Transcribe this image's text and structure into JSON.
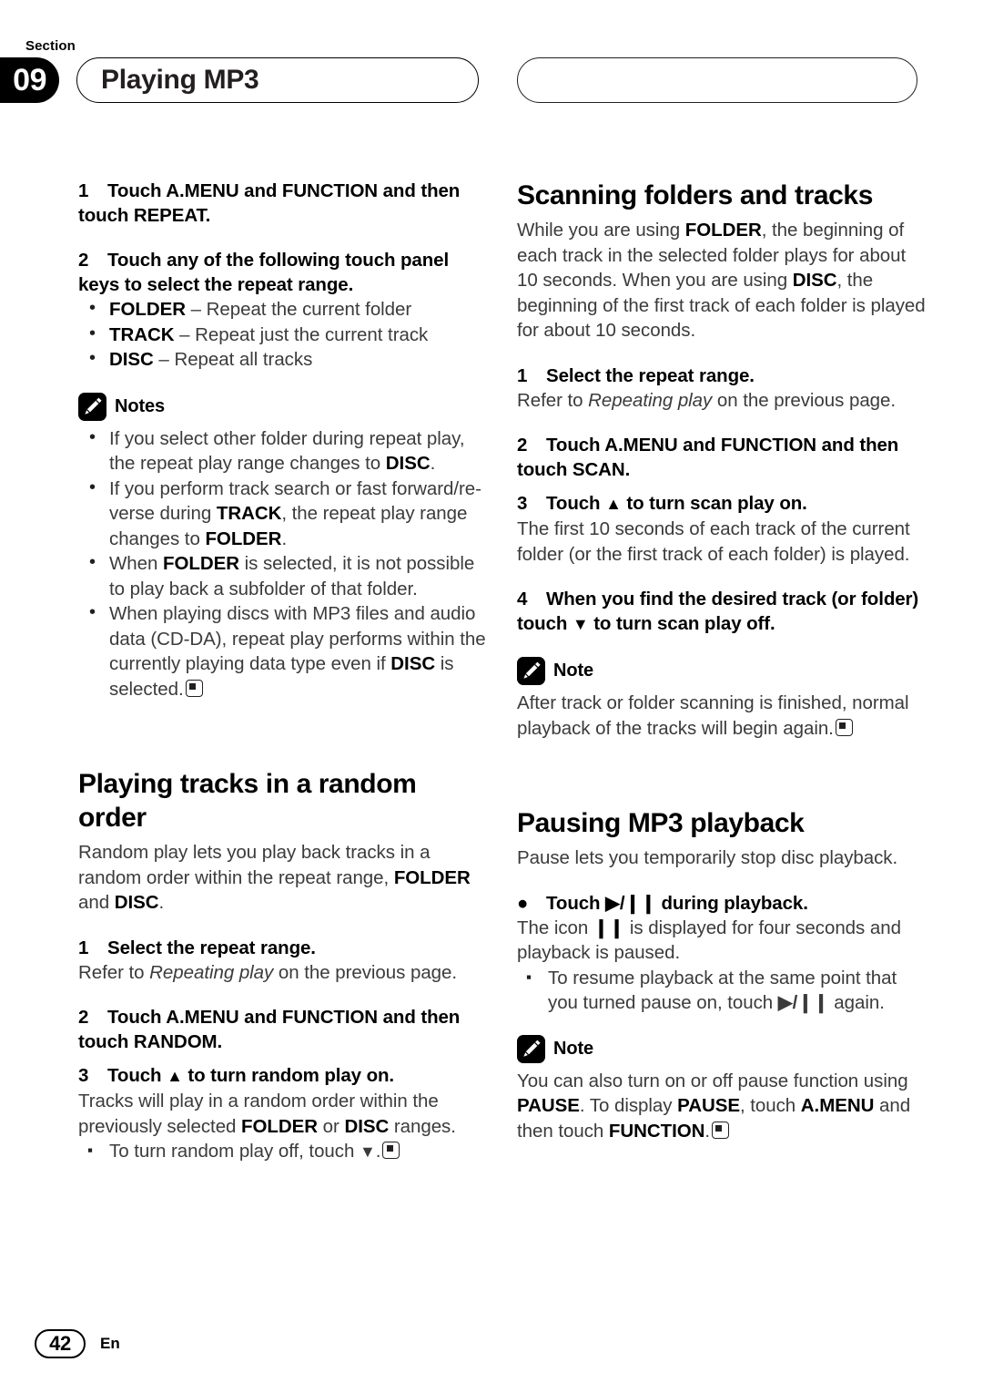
{
  "header": {
    "section_label": "Section",
    "section_number": "09",
    "title": "Playing MP3"
  },
  "footer": {
    "page_number": "42",
    "language": "En"
  },
  "icons": {
    "note": "pencil-icon",
    "end_mark": "end-of-section-marker"
  },
  "left_column": {
    "step1": {
      "number": "1",
      "text": "Touch A.MENU and FUNCTION and then touch REPEAT."
    },
    "step2": {
      "number": "2",
      "text": "Touch any of the following touch panel keys to select the repeat range."
    },
    "repeat_options": [
      {
        "term": "FOLDER",
        "dash": " – ",
        "desc": "Repeat the current folder"
      },
      {
        "term": "TRACK",
        "dash": " – ",
        "desc": "Repeat just the current track"
      },
      {
        "term": "DISC",
        "dash": " – ",
        "desc": "Repeat all tracks"
      }
    ],
    "notes_title": "Notes",
    "notes": [
      {
        "p1": "If you select other folder during repeat play, the repeat play range changes to ",
        "b1": "DISC",
        "p2": "."
      },
      {
        "p1": "If you perform track search or fast forward/re-verse during ",
        "b1": "TRACK",
        "p2": ", the repeat play range changes to ",
        "b2": "FOLDER",
        "p3": "."
      },
      {
        "p1": "When ",
        "b1": "FOLDER",
        "p2": " is selected, it is not possible to play back a subfolder of that folder."
      },
      {
        "p1": "When playing discs with MP3 files and audio data (CD-DA), repeat play performs within the currently playing data type even if ",
        "b1": "DISC",
        "p2": " is selected."
      }
    ],
    "random_heading": "Playing tracks in a random order",
    "random_intro_1": "Random play lets you play back tracks in a random order within the repeat range, ",
    "random_intro_b1": "FOLDER",
    "random_intro_2": " and ",
    "random_intro_b2": "DISC",
    "random_intro_3": ".",
    "random_step1": {
      "number": "1",
      "text": "Select the repeat range."
    },
    "random_step1_body_1": "Refer to ",
    "random_step1_body_italic": "Repeating play",
    "random_step1_body_2": " on the previous page.",
    "random_step2": {
      "number": "2",
      "text": "Touch A.MENU and FUNCTION and then touch RANDOM."
    },
    "random_step3": {
      "number": "3",
      "text_before": "Touch ",
      "symbol": "▲",
      "text_after": " to turn random play on."
    },
    "random_step3_body_1": "Tracks will play in a random order within the previously selected ",
    "random_step3_body_b1": "FOLDER",
    "random_step3_body_2": " or ",
    "random_step3_body_b2": "DISC",
    "random_step3_body_3": " ranges.",
    "random_sub_bullet_1": "To turn random play off, touch ",
    "random_sub_bullet_symbol": "▼",
    "random_sub_bullet_2": "."
  },
  "right_column": {
    "scanning_heading": "Scanning folders and tracks",
    "scanning_intro_1": "While you are using ",
    "scanning_intro_b1": "FOLDER",
    "scanning_intro_2": ", the beginning of each track in the selected folder plays for about 10 seconds. When you are using ",
    "scanning_intro_b2": "DISC",
    "scanning_intro_3": ", the beginning of the first track of each folder is played for about 10 seconds.",
    "scan_step1": {
      "number": "1",
      "text": "Select the repeat range."
    },
    "scan_step1_body_1": "Refer to ",
    "scan_step1_body_italic": "Repeating play",
    "scan_step1_body_2": " on the previous page.",
    "scan_step2": {
      "number": "2",
      "text": "Touch A.MENU and FUNCTION and then touch SCAN."
    },
    "scan_step3": {
      "number": "3",
      "text_before": "Touch ",
      "symbol": "▲",
      "text_after": " to turn scan play on."
    },
    "scan_step3_body": "The first 10 seconds of each track of the current folder (or the first track of each folder) is played.",
    "scan_step4": {
      "number": "4",
      "text_before": "When you find the desired track (or folder) touch ",
      "symbol": "▼",
      "text_after": " to turn scan play off."
    },
    "scan_note_title": "Note",
    "scan_note_body": "After track or folder scanning is finished, normal playback of the tracks will begin again.",
    "pausing_heading": "Pausing MP3 playback",
    "pausing_intro": "Pause lets you temporarily stop disc playback.",
    "pause_bullet": {
      "bullet": "●",
      "text_before": "Touch ",
      "symbol": "▶/❙❙",
      "text_after": " during playback."
    },
    "pause_body_1": "The icon ",
    "pause_body_symbol": "❙❙",
    "pause_body_2": " is displayed for four seconds and playback is paused.",
    "pause_sub_bullet_1": "To resume playback at the same point that you turned pause on, touch ",
    "pause_sub_bullet_symbol": "▶/❙❙",
    "pause_sub_bullet_2": " again.",
    "pause_note_title": "Note",
    "pause_note_1": "You can also turn on or off pause function using ",
    "pause_note_b1": "PAUSE",
    "pause_note_2": ". To display ",
    "pause_note_b2": "PAUSE",
    "pause_note_3": ", touch ",
    "pause_note_b3": "A.MENU",
    "pause_note_4": " and then touch ",
    "pause_note_b4": "FUNCTION",
    "pause_note_5": "."
  }
}
